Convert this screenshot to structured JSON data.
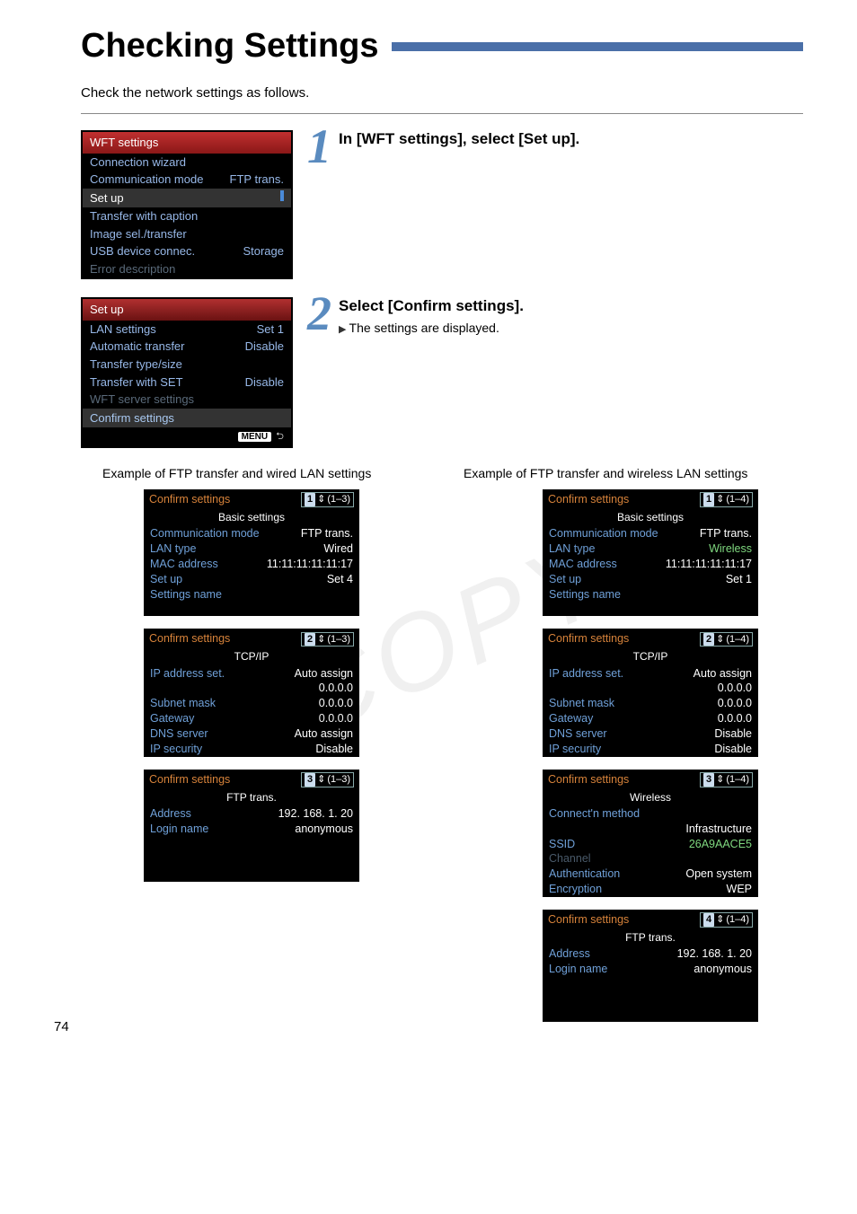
{
  "page": {
    "title": "Checking Settings",
    "intro": "Check the network settings as follows.",
    "page_number": "74"
  },
  "step1": {
    "num": "1",
    "heading": "In [WFT settings], select [Set up].",
    "menu": {
      "header": "WFT settings",
      "items": [
        {
          "l": "Connection wizard",
          "r": ""
        },
        {
          "l": "Communication mode",
          "r": "FTP trans."
        }
      ],
      "selected": "Set up",
      "items2": [
        {
          "l": "Transfer with caption",
          "r": ""
        },
        {
          "l": "Image sel./transfer",
          "r": ""
        },
        {
          "l": "USB device connec.",
          "r": "Storage"
        }
      ],
      "dim": "Error description"
    }
  },
  "step2": {
    "num": "2",
    "heading": "Select [Confirm settings].",
    "bullet": "The settings are displayed.",
    "menu": {
      "header": "Set up",
      "items": [
        {
          "l": "LAN settings",
          "r": "Set 1"
        },
        {
          "l": "Automatic transfer",
          "r": "Disable"
        },
        {
          "l": "Transfer type/size",
          "r": ""
        },
        {
          "l": "Transfer with SET",
          "r": "Disable"
        }
      ],
      "dim": "WFT server settings",
      "selected": "Confirm settings",
      "footer_label": "MENU"
    }
  },
  "captions": {
    "left": "Example of FTP transfer and wired LAN settings",
    "right": "Example of FTP transfer and wireless LAN settings"
  },
  "wired": {
    "p1": {
      "title": "Confirm settings",
      "pager_n": "1",
      "pager_r": "(1–3)",
      "sub": "Basic settings",
      "rows": [
        {
          "l": "Communication mode",
          "r": "FTP trans."
        },
        {
          "l": "LAN type",
          "r": "Wired"
        },
        {
          "l": "MAC address",
          "r": "11:11:11:11:11:17"
        },
        {
          "l": "Set up",
          "r": "Set 4"
        },
        {
          "l": "Settings name",
          "r": ""
        }
      ]
    },
    "p2": {
      "title": "Confirm settings",
      "pager_n": "2",
      "pager_r": "(1–3)",
      "sub": "TCP/IP",
      "rows": [
        {
          "l": "IP address set.",
          "r": "Auto assign"
        },
        {
          "l": "",
          "r": "0.0.0.0"
        },
        {
          "l": "Subnet mask",
          "r": "0.0.0.0"
        },
        {
          "l": "Gateway",
          "r": "0.0.0.0"
        },
        {
          "l": "DNS server",
          "r": "Auto assign"
        },
        {
          "l": "IP security",
          "r": "Disable"
        }
      ]
    },
    "p3": {
      "title": "Confirm settings",
      "pager_n": "3",
      "pager_r": "(1–3)",
      "sub": "FTP trans.",
      "rows": [
        {
          "l": "Address",
          "r": "192. 168. 1. 20"
        },
        {
          "l": "Login name",
          "r": "anonymous"
        }
      ]
    }
  },
  "wireless": {
    "p1": {
      "title": "Confirm settings",
      "pager_n": "1",
      "pager_r": "(1–4)",
      "sub": "Basic settings",
      "rows": [
        {
          "l": "Communication mode",
          "r": "FTP trans."
        },
        {
          "l": "LAN type",
          "r": "Wireless"
        },
        {
          "l": "MAC address",
          "r": "11:11:11:11:11:17"
        },
        {
          "l": "Set up",
          "r": "Set 1"
        },
        {
          "l": "Settings name",
          "r": ""
        }
      ]
    },
    "p2": {
      "title": "Confirm settings",
      "pager_n": "2",
      "pager_r": "(1–4)",
      "sub": "TCP/IP",
      "rows": [
        {
          "l": "IP address set.",
          "r": "Auto assign"
        },
        {
          "l": "",
          "r": "0.0.0.0"
        },
        {
          "l": "Subnet mask",
          "r": "0.0.0.0"
        },
        {
          "l": "Gateway",
          "r": "0.0.0.0"
        },
        {
          "l": "DNS server",
          "r": "Disable"
        },
        {
          "l": "IP security",
          "r": "Disable"
        }
      ]
    },
    "p3": {
      "title": "Confirm settings",
      "pager_n": "3",
      "pager_r": "(1–4)",
      "sub": "Wireless",
      "rows": [
        {
          "l": "Connect'n method",
          "r": ""
        },
        {
          "l": "",
          "r": "Infrastructure"
        },
        {
          "l": "SSID",
          "r": "26A9AACE5"
        },
        {
          "l": "Channel",
          "r": "",
          "dim": true
        },
        {
          "l": "Authentication",
          "r": "Open system"
        },
        {
          "l": "Encryption",
          "r": "WEP"
        }
      ]
    },
    "p4": {
      "title": "Confirm settings",
      "pager_n": "4",
      "pager_r": "(1–4)",
      "sub": "FTP trans.",
      "rows": [
        {
          "l": "Address",
          "r": "192. 168. 1. 20"
        },
        {
          "l": "Login name",
          "r": "anonymous"
        }
      ]
    }
  },
  "watermark": "COPY"
}
